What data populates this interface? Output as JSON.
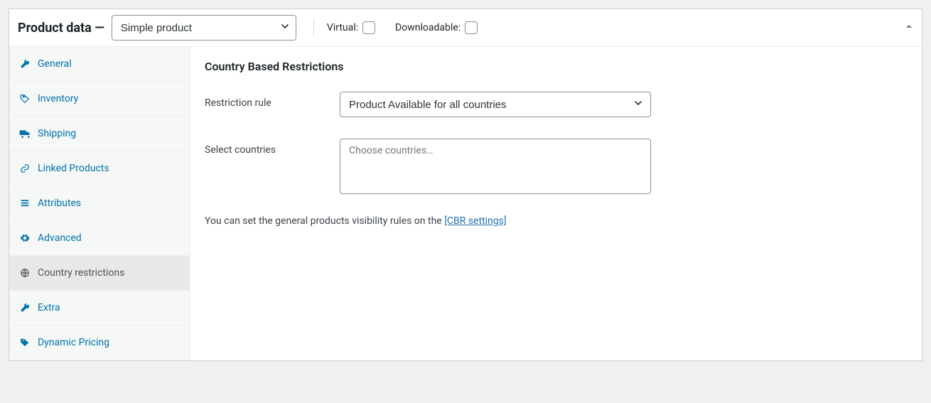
{
  "header": {
    "title": "Product data —",
    "product_type": "Simple product",
    "virtual_label": "Virtual:",
    "downloadable_label": "Downloadable:"
  },
  "tabs": {
    "general": "General",
    "inventory": "Inventory",
    "shipping": "Shipping",
    "linked": "Linked Products",
    "attributes": "Attributes",
    "advanced": "Advanced",
    "country_restrictions": "Country restrictions",
    "extra": "Extra",
    "dynamic_pricing": "Dynamic Pricing"
  },
  "content": {
    "heading": "Country Based Restrictions",
    "restriction_rule_label": "Restriction rule",
    "restriction_rule_value": "Product Available for all countries",
    "select_countries_label": "Select countries",
    "select_countries_placeholder": "Choose countries…",
    "hint_prefix": "You can set the general products visibility rules on the ",
    "hint_link": "[CBR settings]"
  }
}
